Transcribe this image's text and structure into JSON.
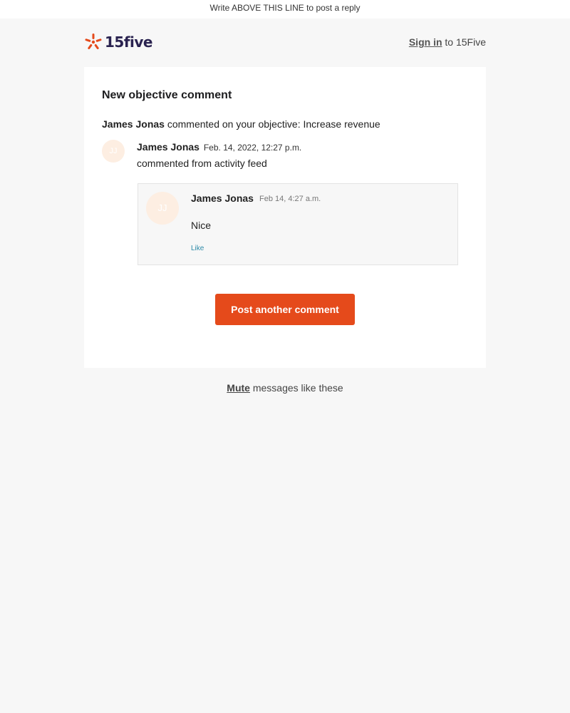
{
  "reply_bar": {
    "text": "Write ABOVE THIS LINE to post a reply"
  },
  "header": {
    "logo_text": "15five",
    "sign_in_link": "Sign in",
    "sign_in_suffix": " to 15Five"
  },
  "card": {
    "title": "New objective comment",
    "summary_author": "James Jonas",
    "summary_rest": " commented on your objective: Increase revenue",
    "author_initials": "JJ",
    "author_name": "James Jonas",
    "timestamp": "Feb. 14, 2022, 12:27 p.m.",
    "source": "commented from activity feed",
    "comment": {
      "initials": "JJ",
      "name": "James Jonas",
      "time": "Feb 14, 4:27 a.m.",
      "text": "Nice",
      "like_label": "Like"
    },
    "post_button": "Post another comment"
  },
  "footer": {
    "mute_link": "Mute",
    "mute_rest": " messages like these"
  },
  "colors": {
    "brand_orange": "#e54a1b",
    "logo_navy": "#2a2350",
    "link_teal": "#2d8aa8",
    "avatar_bg": "#fdeee2"
  }
}
